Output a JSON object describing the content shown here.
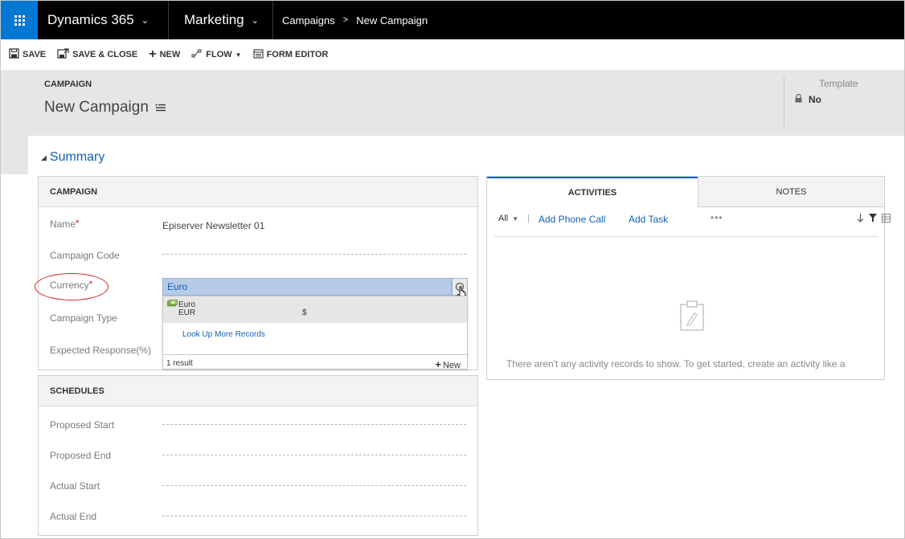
{
  "topnav": {
    "app_title": "Dynamics 365",
    "area": "Marketing",
    "breadcrumb": [
      "Campaigns",
      "New Campaign"
    ]
  },
  "commandbar": {
    "save": "SAVE",
    "save_close": "SAVE & CLOSE",
    "new": "NEW",
    "flow": "FLOW",
    "form_editor": "FORM EDITOR"
  },
  "header": {
    "entity": "CAMPAIGN",
    "title": "New Campaign",
    "template_label": "Template",
    "template_value": "No"
  },
  "section": {
    "title": "Summary"
  },
  "campaign_panel": {
    "heading": "CAMPAIGN",
    "fields": {
      "name_label": "Name",
      "name_value": "Episerver Newsletter 01",
      "code_label": "Campaign Code",
      "currency_label": "Currency",
      "currency_value": "Euro",
      "type_label": "Campaign Type",
      "response_label": "Expected Response(%)"
    },
    "required_marker": "*"
  },
  "lookup_dropdown": {
    "item_name": "Euro",
    "item_code": "EUR",
    "item_symbol": "$",
    "more_records": "Look Up More Records",
    "result_count": "1 result",
    "new_label": "New"
  },
  "schedules_panel": {
    "heading": "SCHEDULES",
    "fields": [
      "Proposed Start",
      "Proposed End",
      "Actual Start",
      "Actual End"
    ]
  },
  "activities_panel": {
    "tab_activities": "ACTIVITIES",
    "tab_notes": "NOTES",
    "filter": "All",
    "add_phone_call": "Add Phone Call",
    "add_task": "Add Task",
    "more": "•••",
    "empty_message": "There aren't any activity records to show. To get started, create an activity like a"
  },
  "colors": {
    "accent": "#1160b7",
    "waffle": "#0078d4",
    "required": "#d00000",
    "highlight_oval": "#d42020"
  },
  "icons": [
    "waffle-icon",
    "chevron-down-icon",
    "save-icon",
    "save-close-icon",
    "plus-icon",
    "flow-icon",
    "form-editor-icon",
    "menu-icon",
    "lock-icon",
    "lookup-icon",
    "currency-icon",
    "sort-icon",
    "filter-icon",
    "grid-view-icon",
    "clipboard-icon"
  ]
}
